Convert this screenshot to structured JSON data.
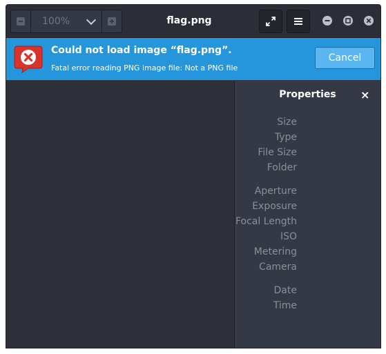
{
  "header": {
    "zoom_level": "100%",
    "title": "flag.png"
  },
  "infobar": {
    "title": "Could not load image “flag.png”.",
    "message": "Fatal error reading PNG image file: Not a PNG file",
    "cancel_label": "Cancel"
  },
  "properties": {
    "title": "Properties",
    "close_glyph": "×",
    "labels": [
      "Size",
      "Type",
      "File Size",
      "Folder",
      "Aperture",
      "Exposure",
      "Focal Length",
      "ISO",
      "Metering",
      "Camera",
      "Date",
      "Time"
    ]
  },
  "colors": {
    "infobar": "#2696dc",
    "error_icon": "#d9342b",
    "window_bg": "#353945"
  }
}
